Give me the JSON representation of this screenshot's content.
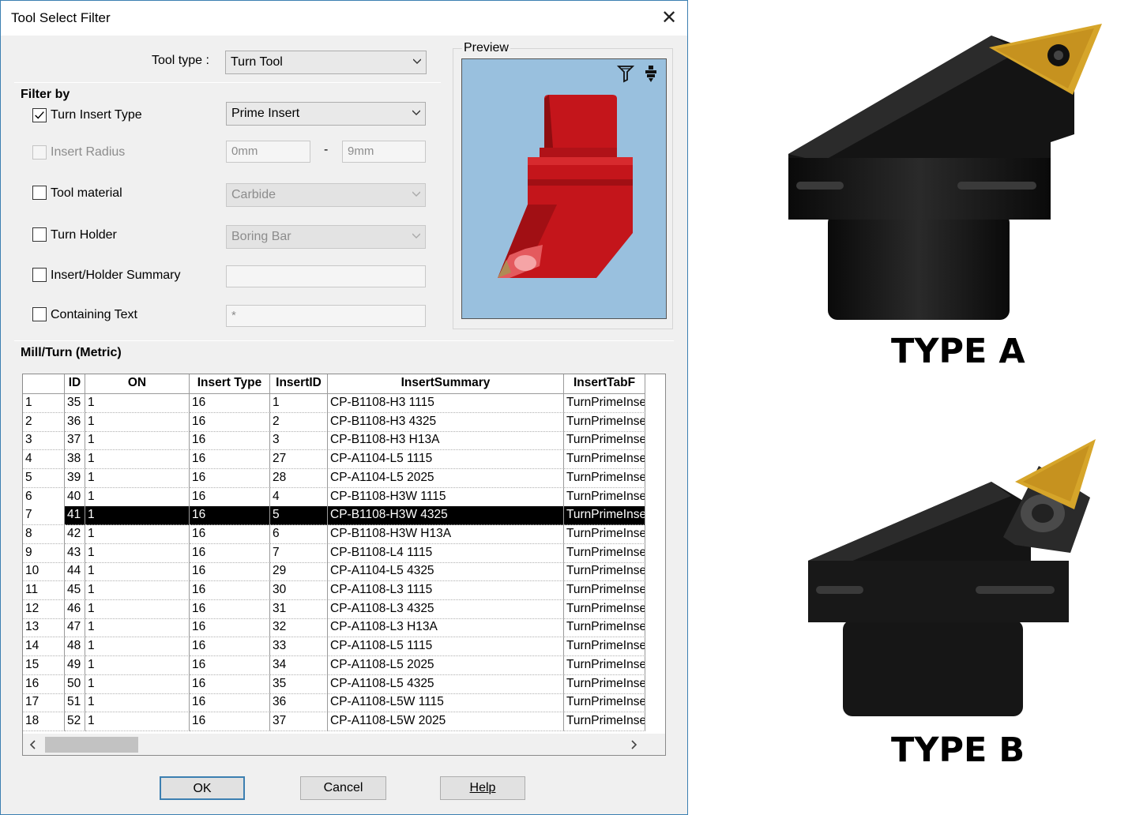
{
  "window": {
    "title": "Tool Select Filter",
    "close_glyph": "✕"
  },
  "tool_type": {
    "label": "Tool type :",
    "value": "Turn Tool"
  },
  "filter_by": {
    "heading": "Filter by",
    "turn_insert_type": {
      "label": "Turn Insert Type",
      "checked": true,
      "value": "Prime Insert"
    },
    "insert_radius": {
      "label": "Insert Radius",
      "checked": false,
      "min": "0mm",
      "separator": "-",
      "max": "9mm"
    },
    "tool_material": {
      "label": "Tool material",
      "checked": false,
      "value": "Carbide"
    },
    "turn_holder": {
      "label": "Turn Holder",
      "checked": false,
      "value": "Boring Bar"
    },
    "insert_holder_summary": {
      "label": "Insert/Holder Summary",
      "checked": false,
      "value": ""
    },
    "containing_text": {
      "label": "Containing Text",
      "checked": false,
      "value": "*"
    }
  },
  "preview": {
    "label": "Preview",
    "icons": [
      "tool-filter-icon",
      "tool-holder-icon"
    ]
  },
  "grid": {
    "title": "Mill/Turn (Metric)",
    "columns": [
      "",
      "ID",
      "ON",
      "Insert Type",
      "InsertID",
      "InsertSummary",
      "InsertTabF"
    ],
    "selected_row": 6,
    "rows": [
      [
        "1",
        "35",
        "1",
        "16",
        "1",
        "CP-B1108-H3 1115",
        "TurnPrimeInse"
      ],
      [
        "2",
        "36",
        "1",
        "16",
        "2",
        "CP-B1108-H3 4325",
        "TurnPrimeInse"
      ],
      [
        "3",
        "37",
        "1",
        "16",
        "3",
        "CP-B1108-H3 H13A",
        "TurnPrimeInse"
      ],
      [
        "4",
        "38",
        "1",
        "16",
        "27",
        "CP-A1104-L5 1115",
        "TurnPrimeInse"
      ],
      [
        "5",
        "39",
        "1",
        "16",
        "28",
        "CP-A1104-L5 2025",
        "TurnPrimeInse"
      ],
      [
        "6",
        "40",
        "1",
        "16",
        "4",
        "CP-B1108-H3W 1115",
        "TurnPrimeInse"
      ],
      [
        "7",
        "41",
        "1",
        "16",
        "5",
        "CP-B1108-H3W 4325",
        "TurnPrimeInse"
      ],
      [
        "8",
        "42",
        "1",
        "16",
        "6",
        "CP-B1108-H3W H13A",
        "TurnPrimeInse"
      ],
      [
        "9",
        "43",
        "1",
        "16",
        "7",
        "CP-B1108-L4 1115",
        "TurnPrimeInse"
      ],
      [
        "10",
        "44",
        "1",
        "16",
        "29",
        "CP-A1104-L5 4325",
        "TurnPrimeInse"
      ],
      [
        "11",
        "45",
        "1",
        "16",
        "30",
        "CP-A1108-L3 1115",
        "TurnPrimeInse"
      ],
      [
        "12",
        "46",
        "1",
        "16",
        "31",
        "CP-A1108-L3 4325",
        "TurnPrimeInse"
      ],
      [
        "13",
        "47",
        "1",
        "16",
        "32",
        "CP-A1108-L3 H13A",
        "TurnPrimeInse"
      ],
      [
        "14",
        "48",
        "1",
        "16",
        "33",
        "CP-A1108-L5 1115",
        "TurnPrimeInse"
      ],
      [
        "15",
        "49",
        "1",
        "16",
        "34",
        "CP-A1108-L5 2025",
        "TurnPrimeInse"
      ],
      [
        "16",
        "50",
        "1",
        "16",
        "35",
        "CP-A1108-L5 4325",
        "TurnPrimeInse"
      ],
      [
        "17",
        "51",
        "1",
        "16",
        "36",
        "CP-A1108-L5W 1115",
        "TurnPrimeInse"
      ],
      [
        "18",
        "52",
        "1",
        "16",
        "37",
        "CP-A1108-L5W 2025",
        "TurnPrimeInse"
      ]
    ]
  },
  "buttons": {
    "ok": "OK",
    "cancel": "Cancel",
    "help": "Help"
  },
  "figures": {
    "type_a": "TYPE A",
    "type_b": "TYPE B"
  },
  "colors": {
    "preview_bg": "#99c0de",
    "tool_red": "#c4151b",
    "insert_gold": "#d6a52a",
    "holder_black": "#111111"
  }
}
